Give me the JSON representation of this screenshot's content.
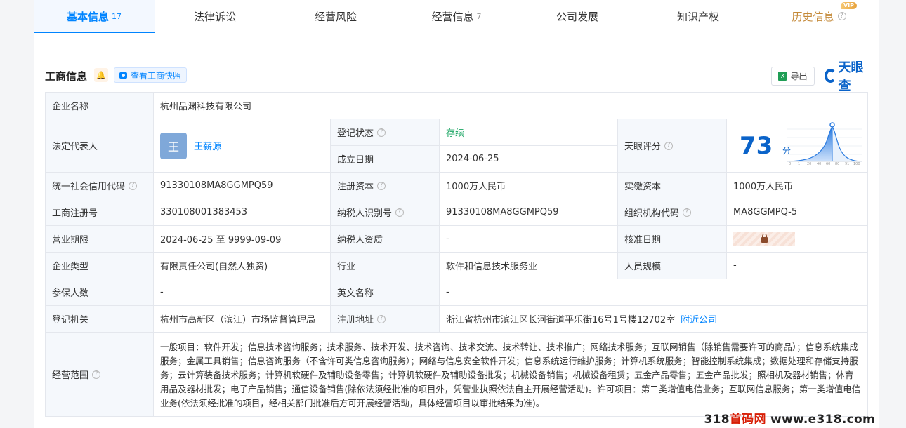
{
  "tabs": [
    {
      "label": "基本信息",
      "count": "17"
    },
    {
      "label": "法律诉讼",
      "count": ""
    },
    {
      "label": "经营风险",
      "count": ""
    },
    {
      "label": "经营信息",
      "count": "7"
    },
    {
      "label": "公司发展",
      "count": ""
    },
    {
      "label": "知识产权",
      "count": ""
    },
    {
      "label": "历史信息",
      "count": "",
      "badge": "VIP"
    }
  ],
  "section": {
    "title": "工商信息",
    "snapshot_label": "查看工商快照",
    "export_label": "导出",
    "export_icon_text": "X",
    "brand": "天眼查"
  },
  "company": {
    "name_label": "企业名称",
    "name": "杭州品渊科技有限公司",
    "legal_rep_label": "法定代表人",
    "legal_rep_avatar": "王",
    "legal_rep": "王薪源",
    "status_label": "登记状态",
    "status": "存续",
    "founded_label": "成立日期",
    "founded": "2024-06-25",
    "score_label": "天眼评分",
    "score": "73",
    "score_unit": "分",
    "score_axis": [
      "0",
      "1",
      "20",
      "40",
      "60",
      "80",
      "91",
      "100"
    ],
    "credit_code_label": "统一社会信用代码",
    "credit_code": "91330108MA8GGMPQ59",
    "reg_capital_label": "注册资本",
    "reg_capital": "1000万人民币",
    "paid_capital_label": "实缴资本",
    "paid_capital": "1000万人民币",
    "reg_no_label": "工商注册号",
    "reg_no": "330108001383453",
    "taxpayer_id_label": "纳税人识别号",
    "taxpayer_id": "91330108MA8GGMPQ59",
    "org_code_label": "组织机构代码",
    "org_code": "MA8GGMPQ-5",
    "term_label": "营业期限",
    "term": "2024-06-25 至 9999-09-09",
    "taxpayer_qual_label": "纳税人资质",
    "taxpayer_qual": "-",
    "approve_date_label": "核准日期",
    "type_label": "企业类型",
    "type": "有限责任公司(自然人独资)",
    "industry_label": "行业",
    "industry": "软件和信息技术服务业",
    "staff_label": "人员规模",
    "staff": "-",
    "insured_label": "参保人数",
    "insured": "-",
    "en_name_label": "英文名称",
    "en_name": "-",
    "authority_label": "登记机关",
    "authority": "杭州市高新区（滨江）市场监督管理局",
    "address_label": "注册地址",
    "address": "浙江省杭州市滨江区长河街道平乐街16号1号楼12702室",
    "nearby_label": "附近公司",
    "scope_label": "经营范围",
    "scope": "一般项目：软件开发；信息技术咨询服务；技术服务、技术开发、技术咨询、技术交流、技术转让、技术推广；网络技术服务；互联网销售（除销售需要许可的商品）；信息系统集成服务；金属工具销售；信息咨询服务（不含许可类信息咨询服务）；网络与信息安全软件开发；信息系统运行维护服务；计算机系统服务；智能控制系统集成；数据处理和存储支持服务；云计算装备技术服务；计算机软硬件及辅助设备零售；计算机软硬件及辅助设备批发；机械设备销售；机械设备租赁；五金产品零售；五金产品批发；照相机及器材销售；体育用品及器材批发；电子产品销售；通信设备销售(除依法须经批准的项目外，凭营业执照依法自主开展经营活动)。许可项目：第二类增值电信业务；互联网信息服务；第一类增值电信业务(依法须经批准的项目，经相关部门批准后方可开展经营活动，具体经营项目以审批结果为准)。"
  },
  "watermark": {
    "prefix": "318",
    "red": "首码网",
    "suffix": " www.e318.com"
  }
}
